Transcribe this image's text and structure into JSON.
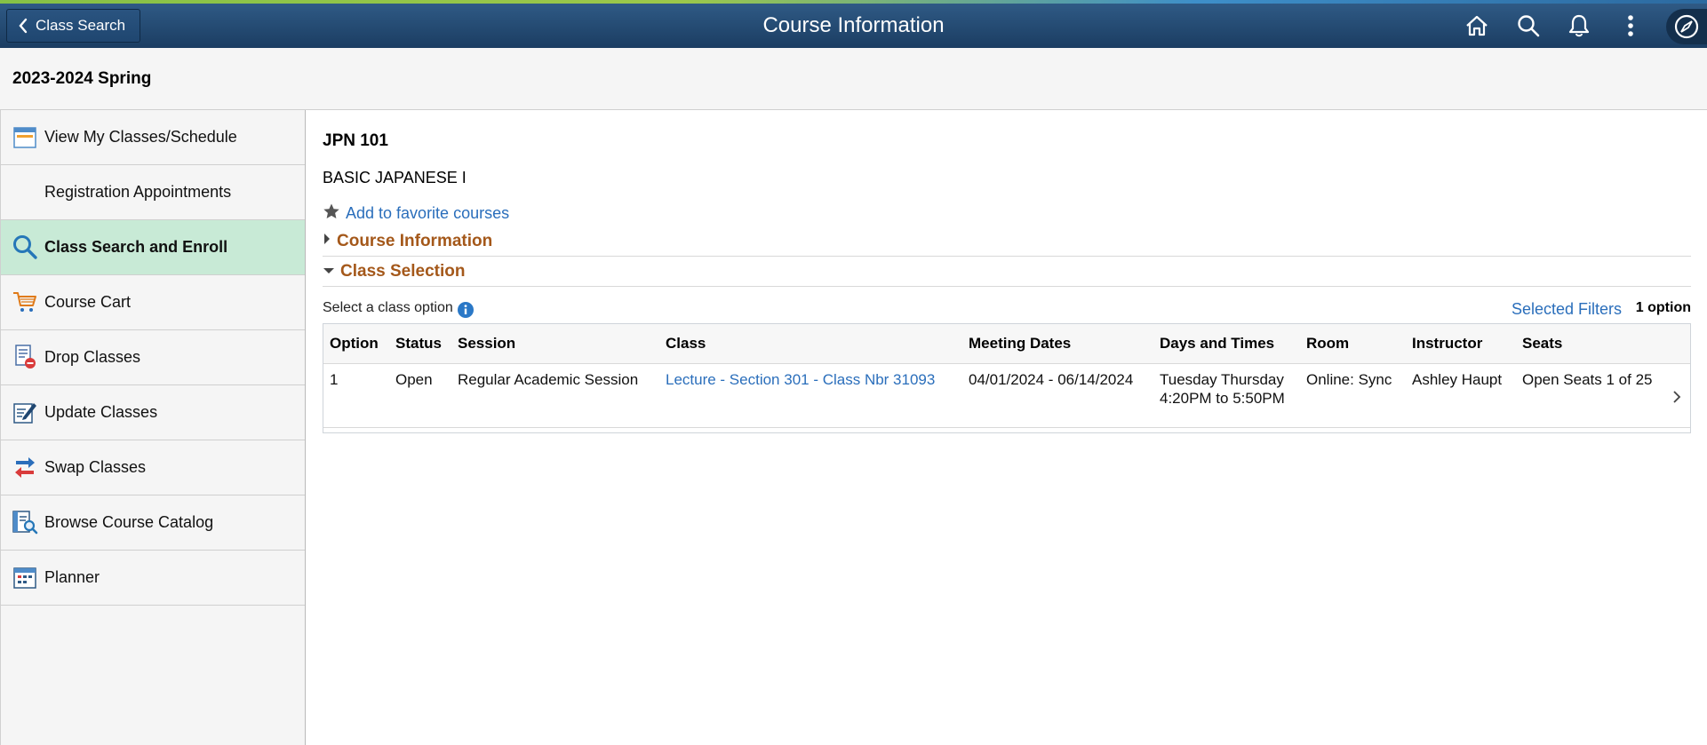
{
  "header": {
    "back_label": "Class Search",
    "title": "Course Information",
    "icons": [
      "home-icon",
      "search-icon",
      "bell-icon",
      "more-icon",
      "navbar-compass-icon"
    ]
  },
  "term": "2023-2024 Spring",
  "sidebar": {
    "items": [
      {
        "label": "View My Classes/Schedule",
        "icon": "calendar-icon"
      },
      {
        "label": "Registration Appointments",
        "icon": ""
      },
      {
        "label": "Class Search and Enroll",
        "icon": "search-icon",
        "active": true
      },
      {
        "label": "Course Cart",
        "icon": "cart-icon"
      },
      {
        "label": "Drop Classes",
        "icon": "drop-icon"
      },
      {
        "label": "Update Classes",
        "icon": "edit-icon"
      },
      {
        "label": "Swap Classes",
        "icon": "swap-icon"
      },
      {
        "label": "Browse Course Catalog",
        "icon": "catalog-icon"
      },
      {
        "label": "Planner",
        "icon": "planner-icon"
      }
    ]
  },
  "course": {
    "code": "JPN 101",
    "title": "BASIC JAPANESE I",
    "favorite_label": "Add to favorite courses"
  },
  "sections": {
    "course_info": "Course Information",
    "class_selection": "Class Selection"
  },
  "selection": {
    "label": "Select a class option",
    "filters_label": "Selected Filters",
    "count_label": "1 option"
  },
  "table": {
    "headers": {
      "option": "Option",
      "status": "Status",
      "session": "Session",
      "class": "Class",
      "meeting_dates": "Meeting Dates",
      "days_times": "Days and Times",
      "room": "Room",
      "instructor": "Instructor",
      "seats": "Seats"
    },
    "rows": [
      {
        "option": "1",
        "status": "Open",
        "session": "Regular Academic Session",
        "class": "Lecture - Section 301 - Class Nbr 31093",
        "meeting_dates": "04/01/2024 - 06/14/2024",
        "days": "Tuesday Thursday",
        "times": "4:20PM to 5:50PM",
        "room": "Online: Sync",
        "instructor": "Ashley Haupt",
        "seats": "Open Seats 1 of 25"
      }
    ]
  },
  "colors": {
    "header_bg": "#1f4670",
    "active_item_bg": "#c8ead6",
    "link": "#2a6ebb",
    "section_title": "#a4581a"
  }
}
